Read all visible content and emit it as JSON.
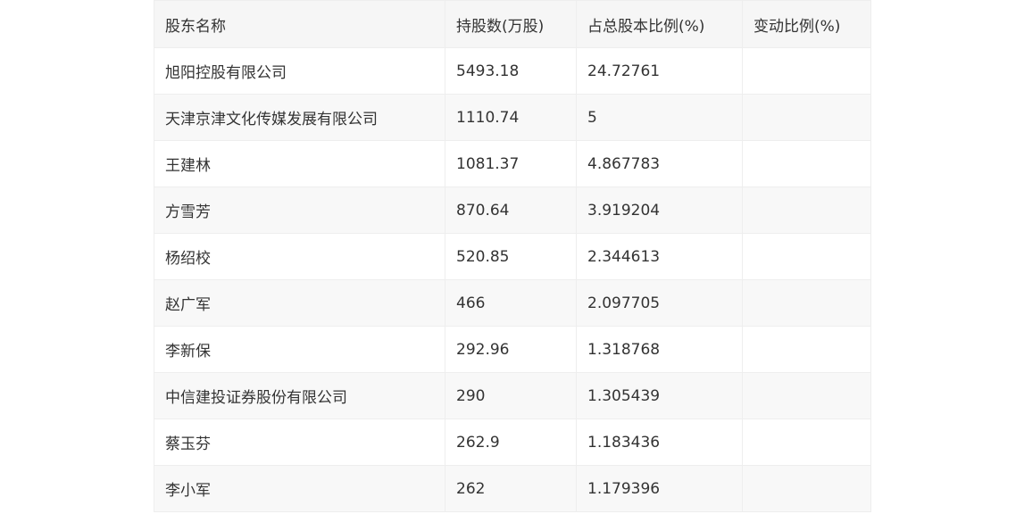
{
  "table": {
    "headers": [
      "股东名称",
      "持股数(万股)",
      "占总股本比例(%)",
      "变动比例(%)"
    ],
    "rows": [
      [
        "旭阳控股有限公司",
        "5493.18",
        "24.72761",
        ""
      ],
      [
        "天津京津文化传媒发展有限公司",
        "1110.74",
        "5",
        ""
      ],
      [
        "王建林",
        "1081.37",
        "4.867783",
        ""
      ],
      [
        "方雪芳",
        "870.64",
        "3.919204",
        ""
      ],
      [
        "杨绍校",
        "520.85",
        "2.344613",
        ""
      ],
      [
        "赵广军",
        "466",
        "2.097705",
        ""
      ],
      [
        "李新保",
        "292.96",
        "1.318768",
        ""
      ],
      [
        "中信建投证券股份有限公司",
        "290",
        "1.305439",
        ""
      ],
      [
        "蔡玉芬",
        "262.9",
        "1.183436",
        ""
      ],
      [
        "李小军",
        "262",
        "1.179396",
        ""
      ]
    ]
  }
}
